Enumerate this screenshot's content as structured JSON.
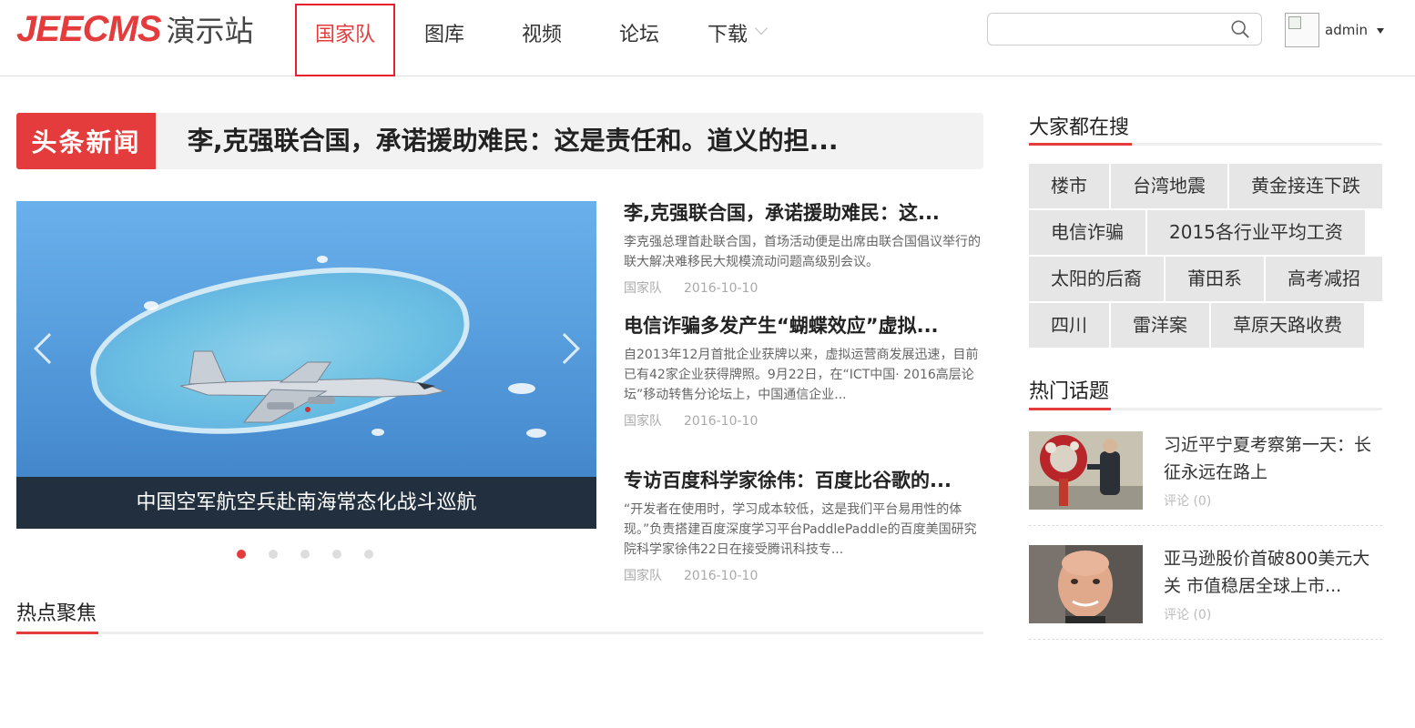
{
  "header": {
    "brand": "JEECMS",
    "site": "演示站",
    "nav": [
      "国家队",
      "图库",
      "视频",
      "论坛",
      "下载"
    ],
    "search_placeholder": "",
    "user": "admin"
  },
  "headline": {
    "tag": "头条新闻",
    "title": "李,克强联合国，承诺援助难民：这是责任和。道义的担..."
  },
  "carousel": {
    "caption": "中国空军航空兵赴南海常态化战斗巡航",
    "slide_count": 5,
    "active_index": 0
  },
  "news": [
    {
      "title": "李,克强联合国，承诺援助难民：这...",
      "summary": "李克强总理首赴联合国，首场活动便是出席由联合国倡议举行的联大解决难移民大规模流动问题高级别会议。",
      "channel": "国家队",
      "date": "2016-10-10"
    },
    {
      "title": "电信诈骗多发产生“蝴蝶效应”虚拟...",
      "summary": "自2013年12月首批企业获牌以来，虚拟运营商发展迅速，目前已有42家企业获得牌照。9月22日，在“ICT中国· 2016高层论坛”移动转售分论坛上，中国通信企业...",
      "channel": "国家队",
      "date": "2016-10-10"
    },
    {
      "title": "专访百度科学家徐伟：百度比谷歌的...",
      "summary": "“开发者在使用时，学习成本较低，这是我们平台易用性的体现。”负责搭建百度深度学习平台PaddlePaddle的百度美国研究院科学家徐伟22日在接受腾讯科技专...",
      "channel": "国家队",
      "date": "2016-10-10"
    }
  ],
  "focus": {
    "title": "热点聚焦"
  },
  "sidebar": {
    "search_title": "大家都在搜",
    "tags": [
      "楼市",
      "台湾地震",
      "黄金接连下跌",
      "电信诈骗",
      "2015各行业平均工资",
      "太阳的后裔",
      "莆田系",
      "高考减招",
      "四川",
      "雷洋案",
      "草原天路收费"
    ],
    "hot_title": "热门话题",
    "topics": [
      {
        "title": "习近平宁夏考察第一天：长征永远在路上",
        "comments": "评论 (0)"
      },
      {
        "title": "亚马逊股价首破800美元大关 市值稳居全球上市...",
        "comments": "评论 (0)"
      }
    ]
  },
  "colors": {
    "accent": "#e43c3c",
    "caption_bg": "#202832",
    "tag_bg": "#e6e6e6"
  }
}
